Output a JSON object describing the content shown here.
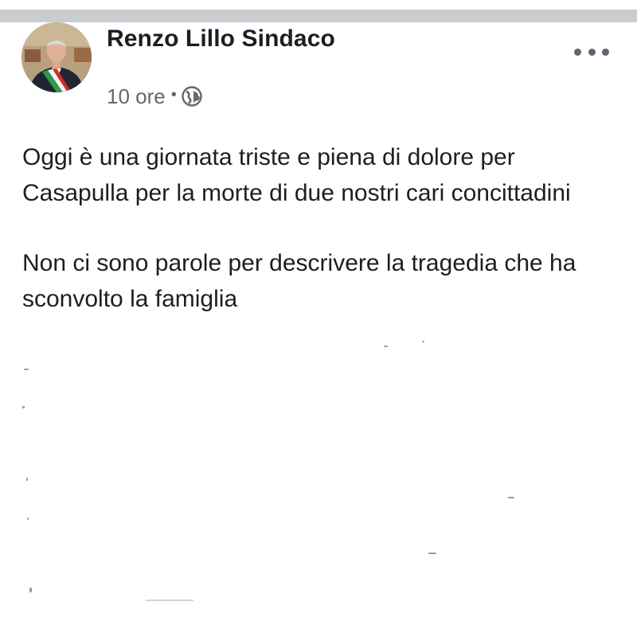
{
  "post": {
    "author": "Renzo Lillo Sindaco",
    "time": "10 ore",
    "separator": "•",
    "privacy_icon": "globe-icon",
    "menu_icon": "more-horizontal-icon",
    "paragraphs": [
      "Oggi è una giornata triste e piena di dolore per Casapulla per la morte di due nostri cari concittadini",
      "Non ci sono parole per descrivere la tragedia che ha sconvolto la famiglia"
    ]
  },
  "colors": {
    "divider": "#c9ccd1",
    "text": "#1c1e21",
    "secondary_text": "#65676b"
  }
}
